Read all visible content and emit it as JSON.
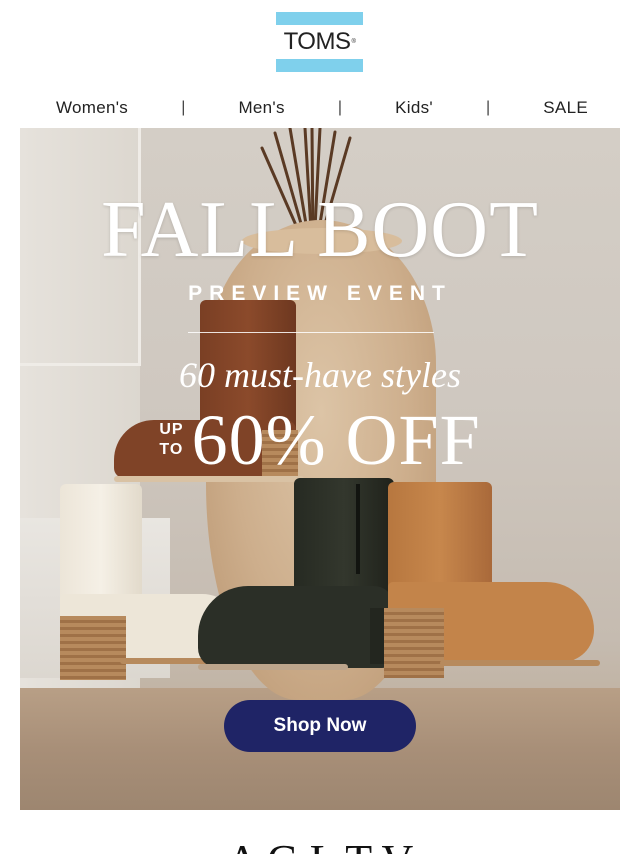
{
  "brand": {
    "logo_text": "TOMS",
    "logo_mark": "®",
    "band_color": "#7fd0ec"
  },
  "nav": {
    "items": [
      {
        "label": "Women's"
      },
      {
        "label": "Men's"
      },
      {
        "label": "Kids'"
      },
      {
        "label": "SALE"
      }
    ],
    "separator": "|"
  },
  "hero": {
    "title": "FALL BOOT",
    "subtitle": "PREVIEW EVENT",
    "styles_text": "60 must-have styles",
    "offer_up": "UP",
    "offer_to": "TO",
    "offer_value": "60% OFF",
    "cta_label": "Shop Now",
    "cta_color": "#1f2466"
  },
  "footer": {
    "heading_partial": "A      G      L      T     V"
  }
}
